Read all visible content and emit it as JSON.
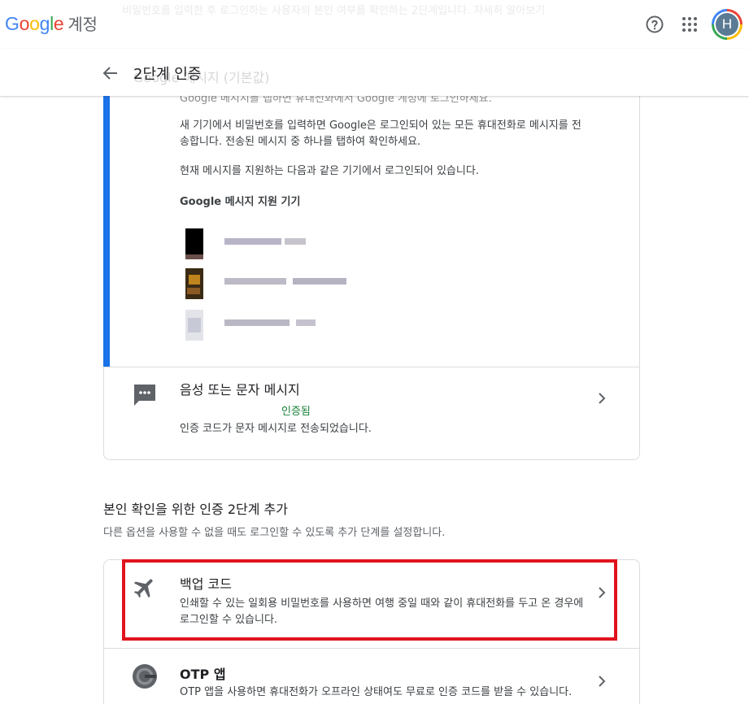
{
  "header": {
    "brand_letters": [
      "G",
      "o",
      "o",
      "g",
      "l",
      "e"
    ],
    "brand_suffix": "계정",
    "faded_notice": "비밀번호를 입력한 후 로그인하는 사용자의 본인 여부를 확인하는 2단계입니다. 자세히 알아보기",
    "avatar_letter": "H",
    "icons": [
      "help-icon",
      "apps-grid-icon"
    ]
  },
  "subheader": {
    "title": "2단계 인증",
    "faded_option": "Google 메시지 (기본값)"
  },
  "google_prompt": {
    "faded_desc": "Google 메시지를 탭하면 휴대전화에서 Google 계정에 로그인하세요.",
    "desc1": "새 기기에서 비밀번호를 입력하면 Google은 로그인되어 있는 모든 휴대전화로 메시지를 전송합니다. 전송된 메시지 중 하나를 탭하여 확인하세요.",
    "desc2": "현재 메시지를 지원하는 다음과 같은 기기에서 로그인되어 있습니다.",
    "devices_title": "Google 메시지 지원 기기"
  },
  "voice_sms": {
    "title": "음성 또는 문자 메시지",
    "status": "인증됨",
    "desc": "인증 코드가 문자 메시지로 전송되었습니다."
  },
  "add_section": {
    "title": "본인 확인을 위한 인증 2단계 추가",
    "desc": "다른 옵션을 사용할 수 없을 때도 로그인할 수 있도록 추가 단계를 설정합니다."
  },
  "backup_codes": {
    "title": "백업 코드",
    "desc": "인쇄할 수 있는 일회용 비밀번호를 사용하면 여행 중일 때와 같이 휴대전화를 두고 온 경우에 로그인할 수 있습니다."
  },
  "otp_app": {
    "title": "OTP 앱",
    "desc": "OTP 앱을 사용하면 휴대전화가 오프라인 상태여도 무료로 인증 코드를 받을 수 있습니다."
  },
  "colors": {
    "accent": "#1a73e8",
    "verified": "#188038",
    "highlight": "#e0141e"
  }
}
